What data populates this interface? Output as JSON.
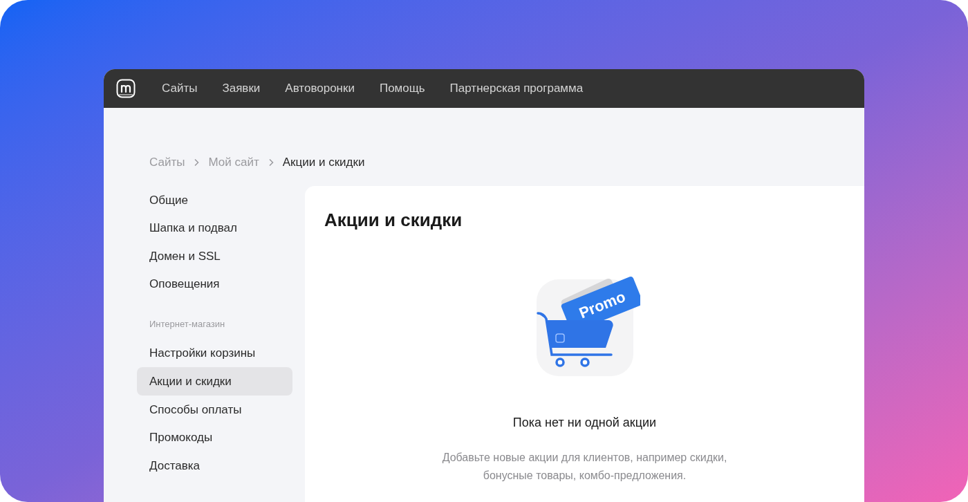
{
  "top_nav": {
    "items": [
      {
        "label": "Сайты"
      },
      {
        "label": "Заявки"
      },
      {
        "label": "Автоворонки"
      },
      {
        "label": "Помощь"
      },
      {
        "label": "Партнерская программа"
      }
    ]
  },
  "breadcrumbs": [
    {
      "label": "Сайты",
      "current": false
    },
    {
      "label": "Мой сайт",
      "current": false
    },
    {
      "label": "Акции и скидки",
      "current": true
    }
  ],
  "sidebar": {
    "items": [
      {
        "kind": "item",
        "label": "Общие",
        "selected": false
      },
      {
        "kind": "item",
        "label": "Шапка и подвал",
        "selected": false
      },
      {
        "kind": "item",
        "label": "Домен и SSL",
        "selected": false
      },
      {
        "kind": "item",
        "label": "Оповещения",
        "selected": false
      },
      {
        "kind": "heading",
        "label": "Интернет-магазин"
      },
      {
        "kind": "item",
        "label": "Настройки корзины",
        "selected": false
      },
      {
        "kind": "item",
        "label": "Акции и скидки",
        "selected": true
      },
      {
        "kind": "item",
        "label": "Способы оплаты",
        "selected": false
      },
      {
        "kind": "item",
        "label": "Промокоды",
        "selected": false
      },
      {
        "kind": "item",
        "label": "Доставка",
        "selected": false
      }
    ]
  },
  "main": {
    "title": "Акции и скидки",
    "illustration_label": "Promo",
    "empty_title": "Пока нет ни одной акции",
    "empty_text": "Добавьте новые акции для клиентов, например скидки, бонусные товары, комбо-предложения."
  }
}
